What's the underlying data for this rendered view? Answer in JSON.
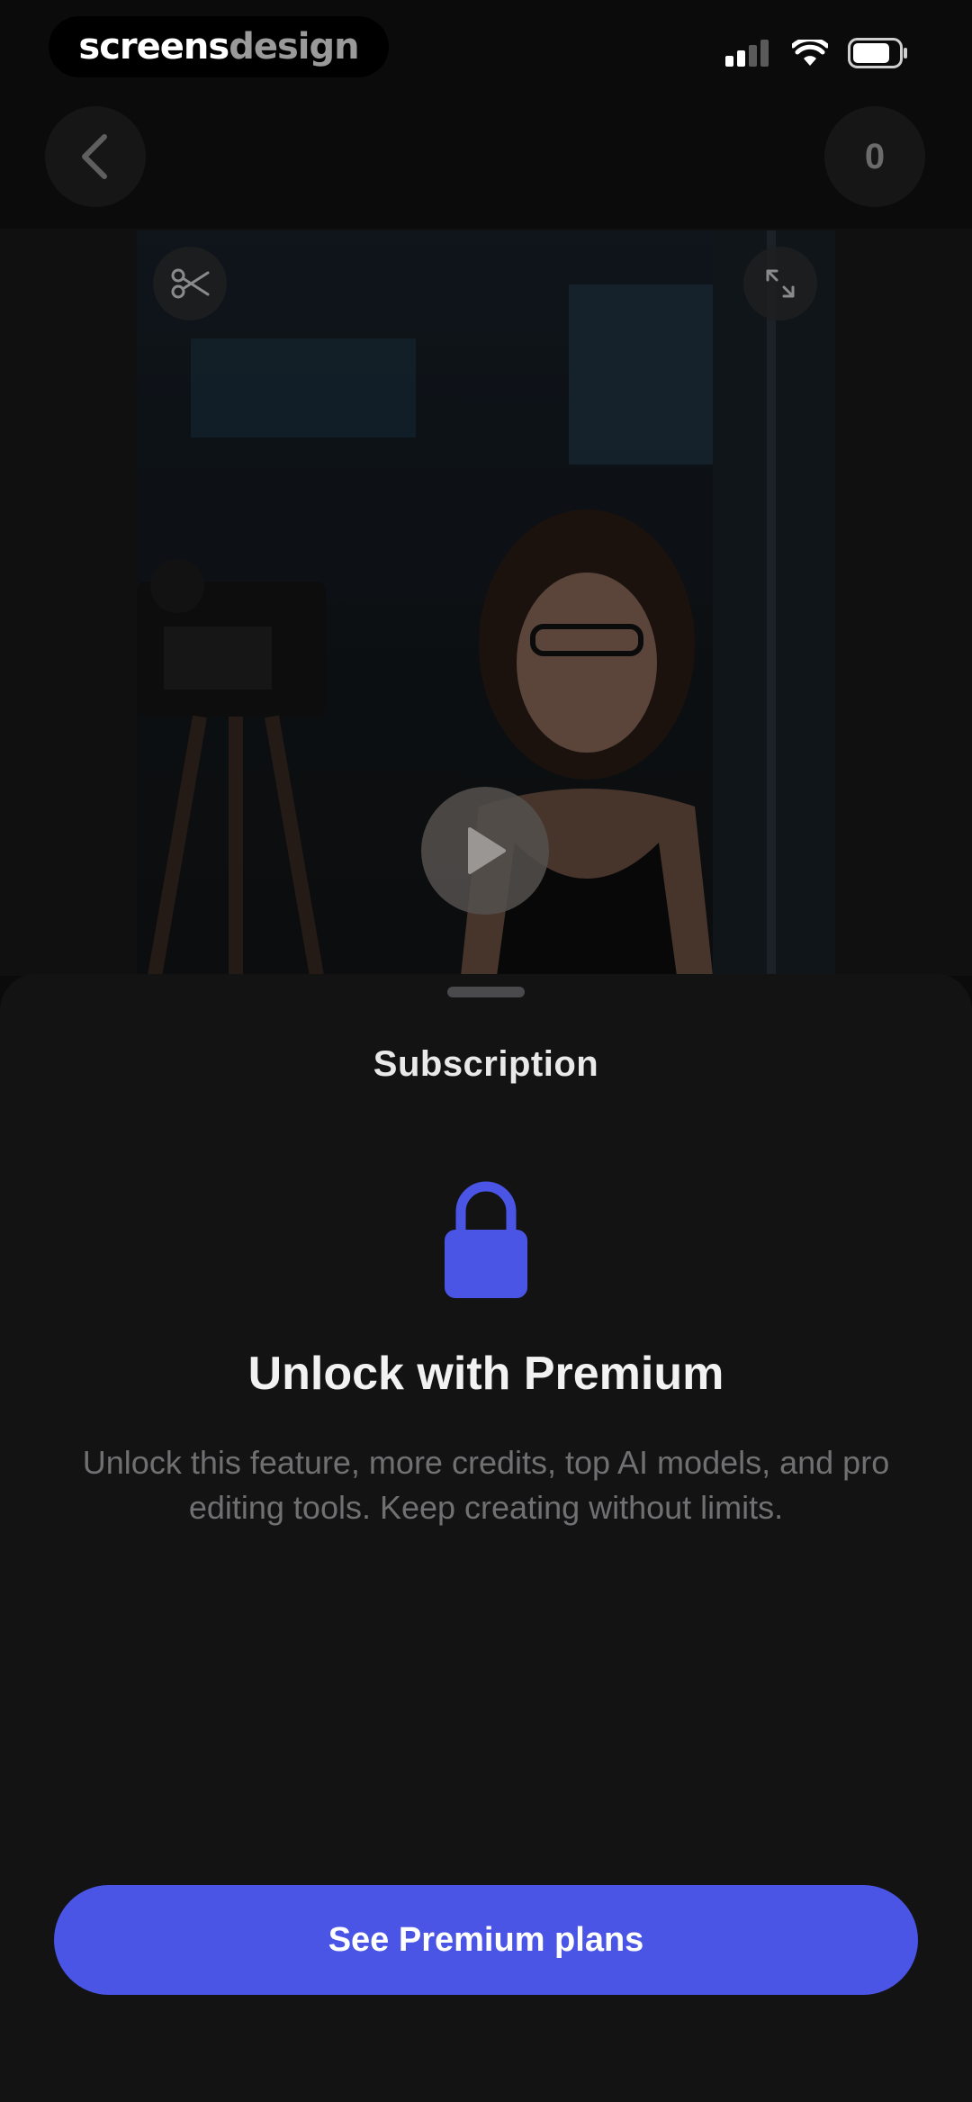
{
  "status_bar": {
    "brand_part1": "screens",
    "brand_part2": "design"
  },
  "header": {
    "credits_count": "0"
  },
  "video": {
    "icons": [
      "scissors-icon",
      "expand-icon",
      "play-icon"
    ]
  },
  "sheet": {
    "title": "Subscription",
    "headline": "Unlock with Premium",
    "description": "Unlock this feature, more credits, top AI models, and pro editing tools. Keep creating without limits.",
    "cta_label": "See Premium plans"
  },
  "colors": {
    "accent": "#4a55e6",
    "background": "#0b0b0c",
    "sheet": "#131314"
  }
}
